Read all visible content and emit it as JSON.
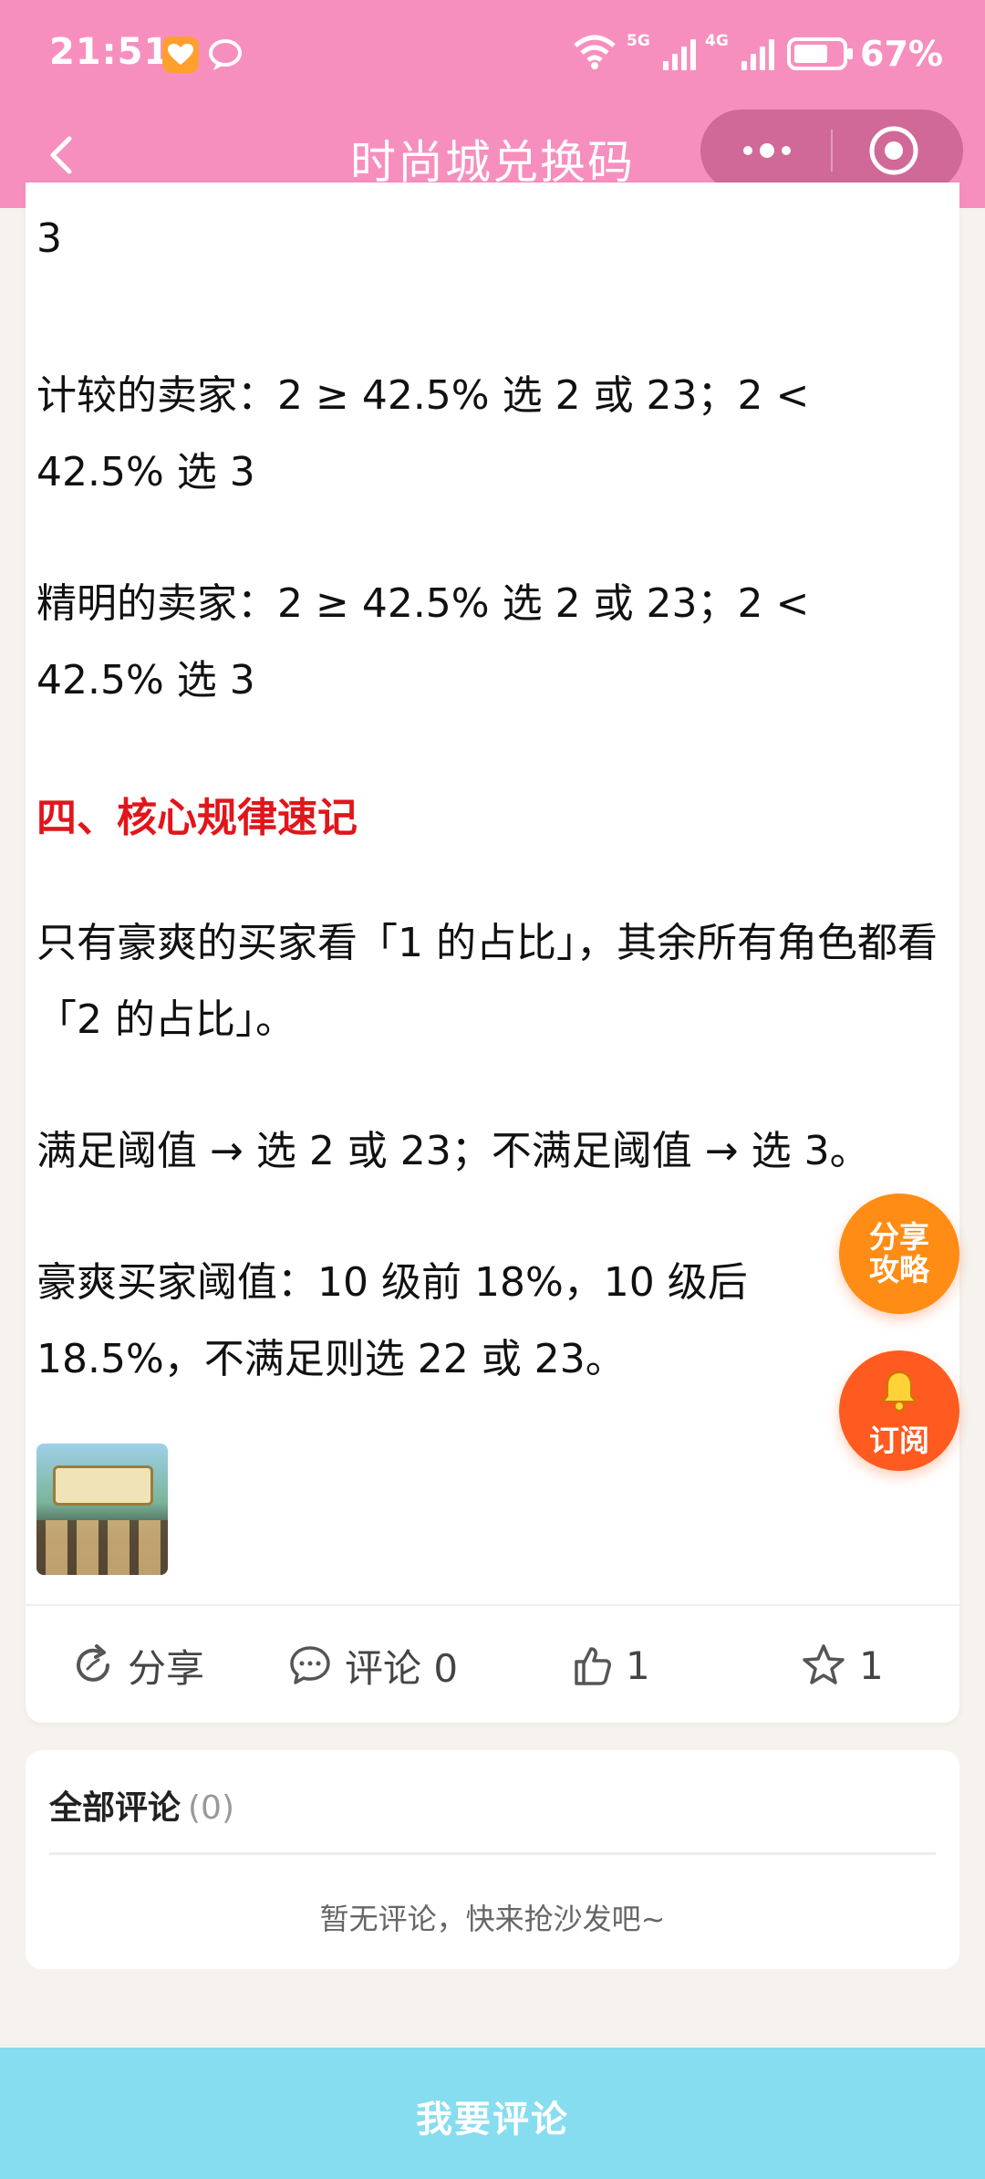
{
  "status_bar": {
    "time": "21:51",
    "net1": "5G",
    "net2": "4G",
    "battery_pct": "67%",
    "battery_level": 0.67
  },
  "header": {
    "title": "时尚城兑换码"
  },
  "article": {
    "para_top_tail": "3",
    "para_jijiao": "计较的卖家：2 ≥ 42.5% 选 2 或 23；2 < 42.5% 选 3",
    "para_jingming": "精明的卖家：2 ≥ 42.5% 选 2 或 23；2 < 42.5% 选 3",
    "heading4": "四、核心规律速记",
    "para_rule1": "只有豪爽的买家看「1 的占比」，其余所有角色都看「2 的占比」。",
    "para_rule2": "满足阈值 → 选 2 或 23；不满足阈值 → 选 3。",
    "para_rule3": "豪爽买家阈值：10 级前 18%，10 级后 18.5%，不满足则选 22 或 23。"
  },
  "actions": {
    "share": "分享",
    "comment": "评论 0",
    "like": "1",
    "favorite": "1"
  },
  "comments": {
    "title": "全部评论",
    "count": "(0)",
    "empty_text": "暂无评论，快来抢沙发吧~"
  },
  "fab": {
    "share_line1": "分享",
    "share_line2": "攻略",
    "subscribe": "订阅"
  },
  "bottom": {
    "comment_button": "我要评论"
  },
  "colors": {
    "header_bg": "#f78fbe",
    "heading_red": "#e0161b",
    "fab_share": "#ff8c14",
    "fab_subscribe": "#ff5a1f",
    "bottom_bar": "#86ddef"
  }
}
